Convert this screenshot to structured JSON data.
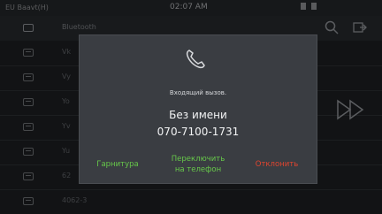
{
  "status_bar": {
    "carrier": "EU Baavt(H)",
    "time": "02:07 AM"
  },
  "background_list": {
    "rows": [
      {
        "label": "Bluetooth"
      },
      {
        "label": "Vk"
      },
      {
        "label": "Vy"
      },
      {
        "label": "Yo"
      },
      {
        "label": "Yv"
      },
      {
        "label": "Yu"
      },
      {
        "label": "62"
      },
      {
        "label": "4062-3"
      }
    ]
  },
  "incoming_call": {
    "title": "Входящий вызов.",
    "caller_name": "Без имени",
    "caller_number": "070-7100-1731",
    "buttons": {
      "headset": "Гарнитура",
      "switch_to_phone_line1": "Переключить",
      "switch_to_phone_line2": "на телефон",
      "reject": "Отклонить"
    },
    "colors": {
      "accept": "#67c84a",
      "reject": "#e0452f",
      "dialog_bg": "#3a3d42"
    },
    "icon": "phone-icon"
  }
}
